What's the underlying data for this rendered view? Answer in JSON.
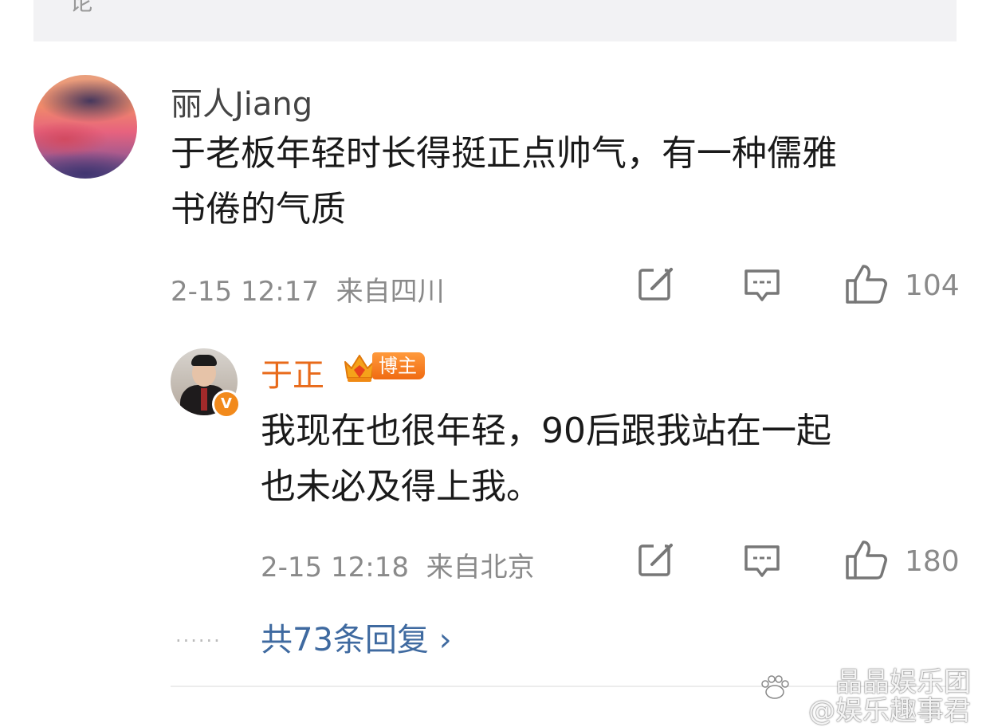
{
  "top_card": {
    "cut_text": "论"
  },
  "comment": {
    "username": "丽人Jiang",
    "text_line1": "于老板年轻时长得挺正点帅气，有一种儒雅",
    "text_line2": "书倦的气质",
    "time": "2-15 12:17",
    "location": "来自四川",
    "likes": "104"
  },
  "reply": {
    "username": "于正",
    "badge": "博主",
    "verified_mark": "V",
    "text_line1": "我现在也很年轻，90后跟我站在一起",
    "text_line2": "也未必及得上我。",
    "time": "2-15 12:18",
    "location": "来自北京",
    "likes": "180"
  },
  "more": {
    "dots": "······",
    "label": "共73条回复 ›"
  },
  "watermark": {
    "line1": "晶晶娱乐团",
    "line2": "@娱乐趣事君"
  },
  "colors": {
    "accent_orange": "#e86a1a",
    "link_blue": "#3f6aa0",
    "meta_gray": "#8a8a8a"
  },
  "icons": [
    "edit-icon",
    "comment-icon",
    "like-icon",
    "crown-icon",
    "chevron-right-icon",
    "baidu-paw-icon"
  ]
}
